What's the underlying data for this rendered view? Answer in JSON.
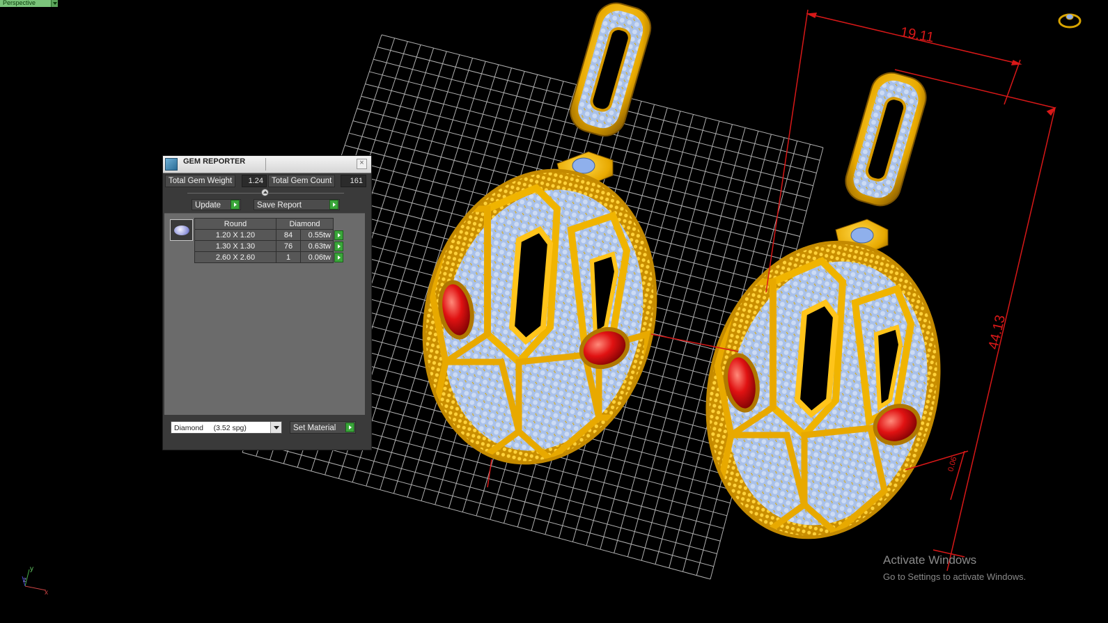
{
  "viewport": {
    "label": "Perspective",
    "dimensions": {
      "width_label": "19.11",
      "height_label": "44.13",
      "depth_label": "0.06"
    },
    "axis": {
      "x": "x",
      "y": "y",
      "z": "z"
    }
  },
  "gem_reporter": {
    "title": "GEM REPORTER",
    "close_glyph": "×",
    "total_weight_label": "Total Gem Weight",
    "total_weight_value": "1.24",
    "total_count_label": "Total Gem Count",
    "total_count_value": "161",
    "update_label": "Update",
    "save_report_label": "Save Report",
    "table": {
      "shape_header": "Round",
      "material_header": "Diamond",
      "rows": [
        {
          "size": "1.20 X 1.20",
          "count": "84",
          "weight": "0.55tw"
        },
        {
          "size": "1.30 X 1.30",
          "count": "76",
          "weight": "0.63tw"
        },
        {
          "size": "2.60 X 2.60",
          "count": "1",
          "weight": "0.06tw"
        }
      ]
    },
    "material_select": "Diamond     (3.52 spg)",
    "set_material_label": "Set Material"
  },
  "watermark": {
    "title": "Activate Windows",
    "subtitle": "Go to Settings to activate Windows."
  },
  "colors": {
    "gold": "#f0b400",
    "gem_blue": "#9db8e6",
    "ruby": "#d81010",
    "dimension_red": "#d81818",
    "grid": "#d0d0d0",
    "go_green": "#3aa63a"
  },
  "icons": [
    "gem-reporter-icon",
    "close-icon",
    "play-arrow-icon",
    "chevron-down-icon",
    "view-cube-icon",
    "axis-triad-icon"
  ]
}
